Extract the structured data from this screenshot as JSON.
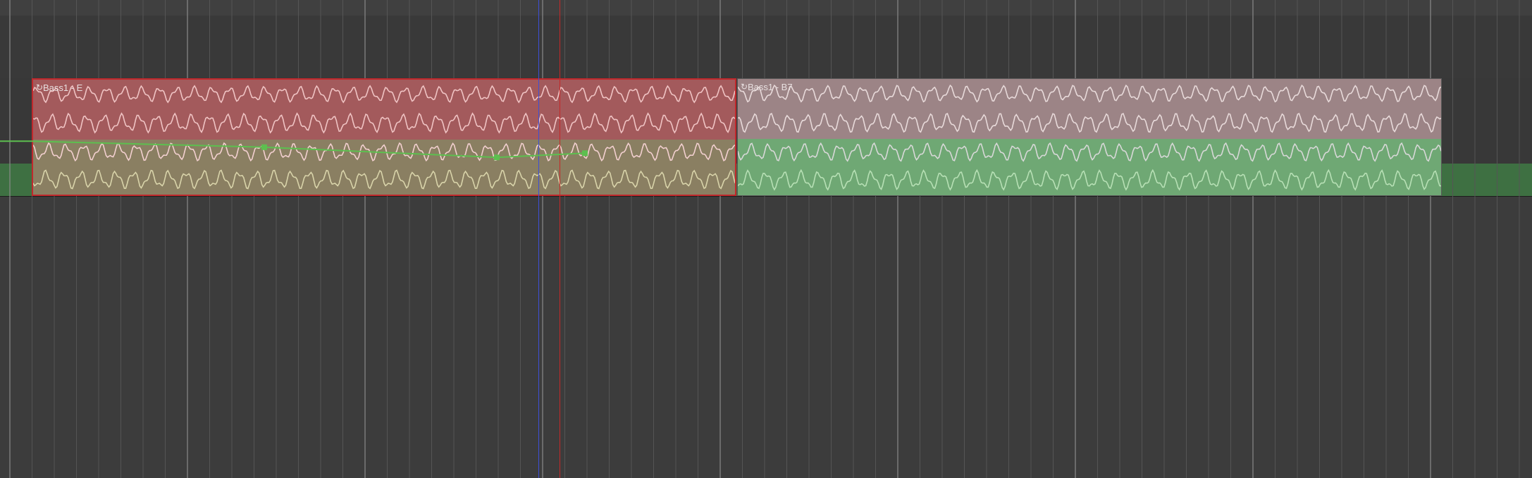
{
  "regions": [
    {
      "name": "Bass1 - E",
      "state": "selected",
      "color": "#c0282c"
    },
    {
      "name": "Bass1 - B7",
      "state": "normal",
      "color": "#9c8486"
    }
  ],
  "automation": {
    "color": "#5dbf4f",
    "points": [
      {
        "bar": 0.0,
        "level": 0.82
      },
      {
        "bar": 3.3,
        "level": 0.72
      },
      {
        "bar": 6.6,
        "level": 0.55
      },
      {
        "bar": 7.85,
        "level": 0.62
      }
    ]
  },
  "colors": {
    "playhead": "#3d4fd6",
    "cursor": "#c62828",
    "background": "#3c3c3c"
  }
}
